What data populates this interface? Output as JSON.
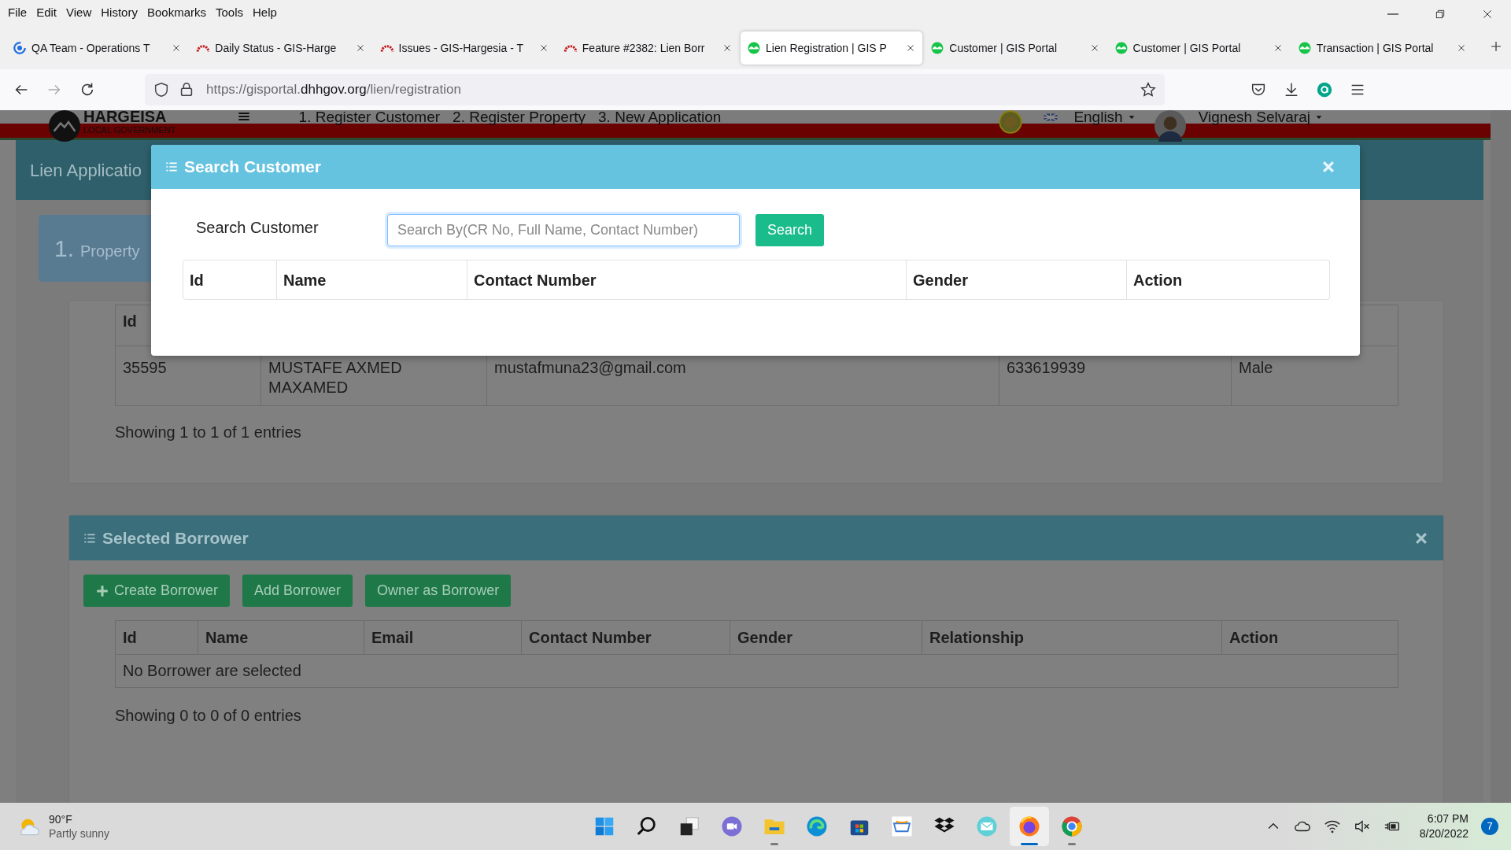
{
  "browser": {
    "menu": [
      "File",
      "Edit",
      "View",
      "History",
      "Bookmarks",
      "Tools",
      "Help"
    ],
    "tabs": [
      {
        "title": "QA Team - Operations T",
        "kind": "ring",
        "selected": false
      },
      {
        "title": "Daily Status - GIS-Harge",
        "kind": "arc",
        "selected": false
      },
      {
        "title": "Issues - GIS-Hargesia - T",
        "kind": "arc",
        "selected": false
      },
      {
        "title": "Feature #2382: Lien Borr",
        "kind": "arc",
        "selected": false
      },
      {
        "title": "Lien Registration | GIS P",
        "kind": "portal",
        "selected": true
      },
      {
        "title": "Customer | GIS Portal",
        "kind": "portal",
        "selected": false
      },
      {
        "title": "Customer | GIS Portal",
        "kind": "portal",
        "selected": false
      },
      {
        "title": "Transaction | GIS Portal",
        "kind": "portal",
        "selected": false
      }
    ],
    "url": {
      "start": "https://gisportal.",
      "domain": "dhhgov.org",
      "path": "/lien/registration"
    }
  },
  "site_header": {
    "logo_title": "HARGEISA",
    "logo_subtitle": "LOCAL GOVERNMENT",
    "nav": [
      "1. Register Customer",
      "2. Register Property",
      "3. New Application"
    ],
    "language": "English",
    "user": "Vignesh Selvaraj"
  },
  "page": {
    "title": "Lien Applicatio",
    "steps": [
      {
        "number": "1.",
        "label": "Property"
      }
    ],
    "owner_table": {
      "columns": [
        "Id"
      ],
      "rows": [
        [
          "35595",
          "MUSTAFE AXMED MAXAMED",
          "mustafmuna23@gmail.com",
          "633619939",
          "Male"
        ]
      ],
      "info": "Showing 1 to 1 of 1 entries"
    },
    "borrower": {
      "title": "Selected Borrower",
      "buttons": [
        {
          "label": "Create Borrower",
          "kind": "create"
        },
        {
          "label": "Add Borrower",
          "kind": "plain"
        },
        {
          "label": "Owner as Borrower",
          "kind": "plain"
        }
      ],
      "columns": [
        "Id",
        "Name",
        "Email",
        "Contact Number",
        "Gender",
        "Relationship",
        "Action"
      ],
      "empty": "No Borrower are selected",
      "info": "Showing 0 to 0 of 0 entries"
    }
  },
  "modal": {
    "title": "Search Customer",
    "search_label": "Search Customer",
    "search": {
      "placeholder": "Search By(CR No, Full Name, Contact Number)"
    },
    "search_button": "Search",
    "columns": [
      "Id",
      "Name",
      "Contact Number",
      "Gender",
      "Action"
    ]
  },
  "taskbar": {
    "weather": {
      "temperature": "90°F",
      "condition": "Partly sunny"
    },
    "apps": [
      {
        "kind": "start",
        "running": false,
        "selected": false
      },
      {
        "kind": "search",
        "running": false,
        "selected": false
      },
      {
        "kind": "taskview",
        "running": false,
        "selected": false
      },
      {
        "kind": "chat",
        "running": false,
        "selected": false
      },
      {
        "kind": "folder",
        "running": true,
        "selected": false
      },
      {
        "kind": "swirl",
        "running": false,
        "selected": false
      },
      {
        "kind": "store",
        "running": false,
        "selected": false
      },
      {
        "kind": "cart",
        "running": false,
        "selected": false
      },
      {
        "kind": "boxes",
        "running": false,
        "selected": false
      },
      {
        "kind": "mail",
        "running": false,
        "selected": false
      },
      {
        "kind": "fox",
        "running": true,
        "selected": true
      },
      {
        "kind": "ring",
        "running": true,
        "selected": false
      }
    ],
    "time": "6:07 PM",
    "date": "8/20/2022",
    "notifications": "7"
  }
}
